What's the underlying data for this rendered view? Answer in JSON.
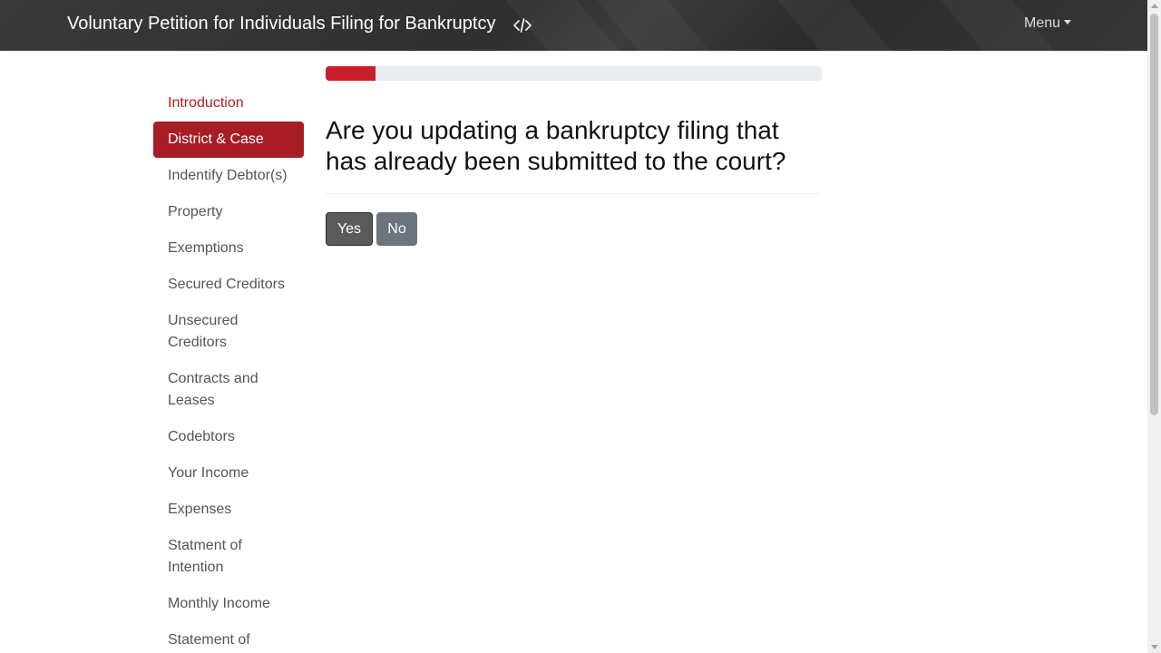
{
  "header": {
    "title": "Voluntary Petition for Individuals Filing for Bankruptcy",
    "code_icon": "code-icon",
    "menu_label": "Menu"
  },
  "progress": {
    "value_percent": 10
  },
  "sidebar": {
    "items": [
      {
        "label": "Introduction",
        "state": "visited"
      },
      {
        "label": "District & Case",
        "state": "active"
      },
      {
        "label": "Indentify Debtor(s)",
        "state": "normal"
      },
      {
        "label": "Property",
        "state": "normal"
      },
      {
        "label": "Exemptions",
        "state": "normal"
      },
      {
        "label": "Secured Creditors",
        "state": "normal"
      },
      {
        "label": "Unsecured Creditors",
        "state": "normal"
      },
      {
        "label": "Contracts and Leases",
        "state": "normal"
      },
      {
        "label": "Codebtors",
        "state": "normal"
      },
      {
        "label": "Your Income",
        "state": "normal"
      },
      {
        "label": "Expenses",
        "state": "normal"
      },
      {
        "label": "Statment of Intention",
        "state": "normal"
      },
      {
        "label": "Monthly Income",
        "state": "normal"
      },
      {
        "label": "Statement of",
        "state": "normal"
      }
    ]
  },
  "question": {
    "text": "Are you updating a bankruptcy filing that has already been submitted to the court?",
    "yes_label": "Yes",
    "no_label": "No"
  },
  "colors": {
    "accent": "#a71d23",
    "progress": "#c8202b",
    "nav_bg": "#333333"
  }
}
